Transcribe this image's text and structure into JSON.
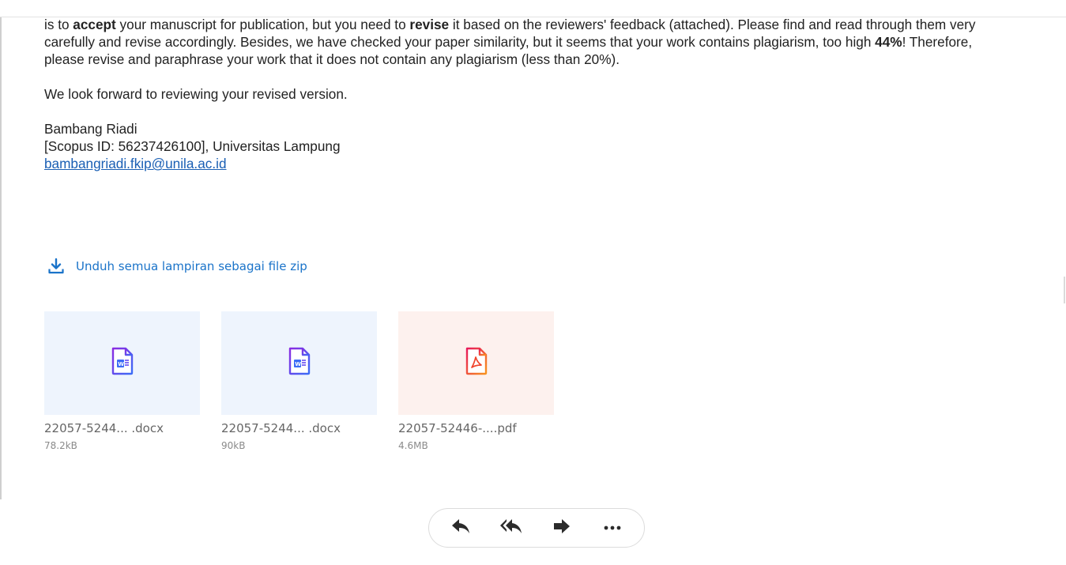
{
  "email": {
    "intro_before_accept": "is to ",
    "intro_accept": "accept",
    "intro_mid": " your manuscript for publication, but you need to ",
    "intro_revise": "revise",
    "intro_after_revise": " it based on the reviewers' feedback (attached).  Please find and read through them very carefully and revise accordingly. Besides, we have checked your paper similarity, but it seems that your work contains plagiarism, too high ",
    "intro_percent": "44%",
    "intro_end": "! Therefore, please revise and paraphrase your work that it does not contain any plagiarism (less than 20%).",
    "outro": "We look forward to reviewing your revised version.",
    "signature": {
      "name": "Bambang Riadi",
      "affiliation": "[Scopus ID: 56237426100], Universitas Lampung",
      "email": "bambangriadi.fkip@unila.ac.id"
    }
  },
  "download_all": {
    "label": "Unduh semua lampiran sebagai file zip",
    "icon": "download-icon"
  },
  "attachments": [
    {
      "name": "22057-5244... .docx",
      "size": "78.2kB",
      "type": "docx",
      "icon": "word-file-icon"
    },
    {
      "name": "22057-5244... .docx",
      "size": "90kB",
      "type": "docx",
      "icon": "word-file-icon"
    },
    {
      "name": "22057-52446-....pdf",
      "size": "4.6MB",
      "type": "pdf",
      "icon": "pdf-file-icon"
    }
  ],
  "actions": [
    {
      "icon": "reply-icon"
    },
    {
      "icon": "reply-all-icon"
    },
    {
      "icon": "forward-icon"
    },
    {
      "icon": "more-icon"
    }
  ],
  "colors": {
    "link": "#1a5fb4",
    "accent": "#1a73c9",
    "doc_thumb_bg": "#eef4fd",
    "pdf_thumb_bg": "#fdf1ee",
    "word_icon": "#5a3ff0",
    "pdf_icon": "#f0452d"
  }
}
